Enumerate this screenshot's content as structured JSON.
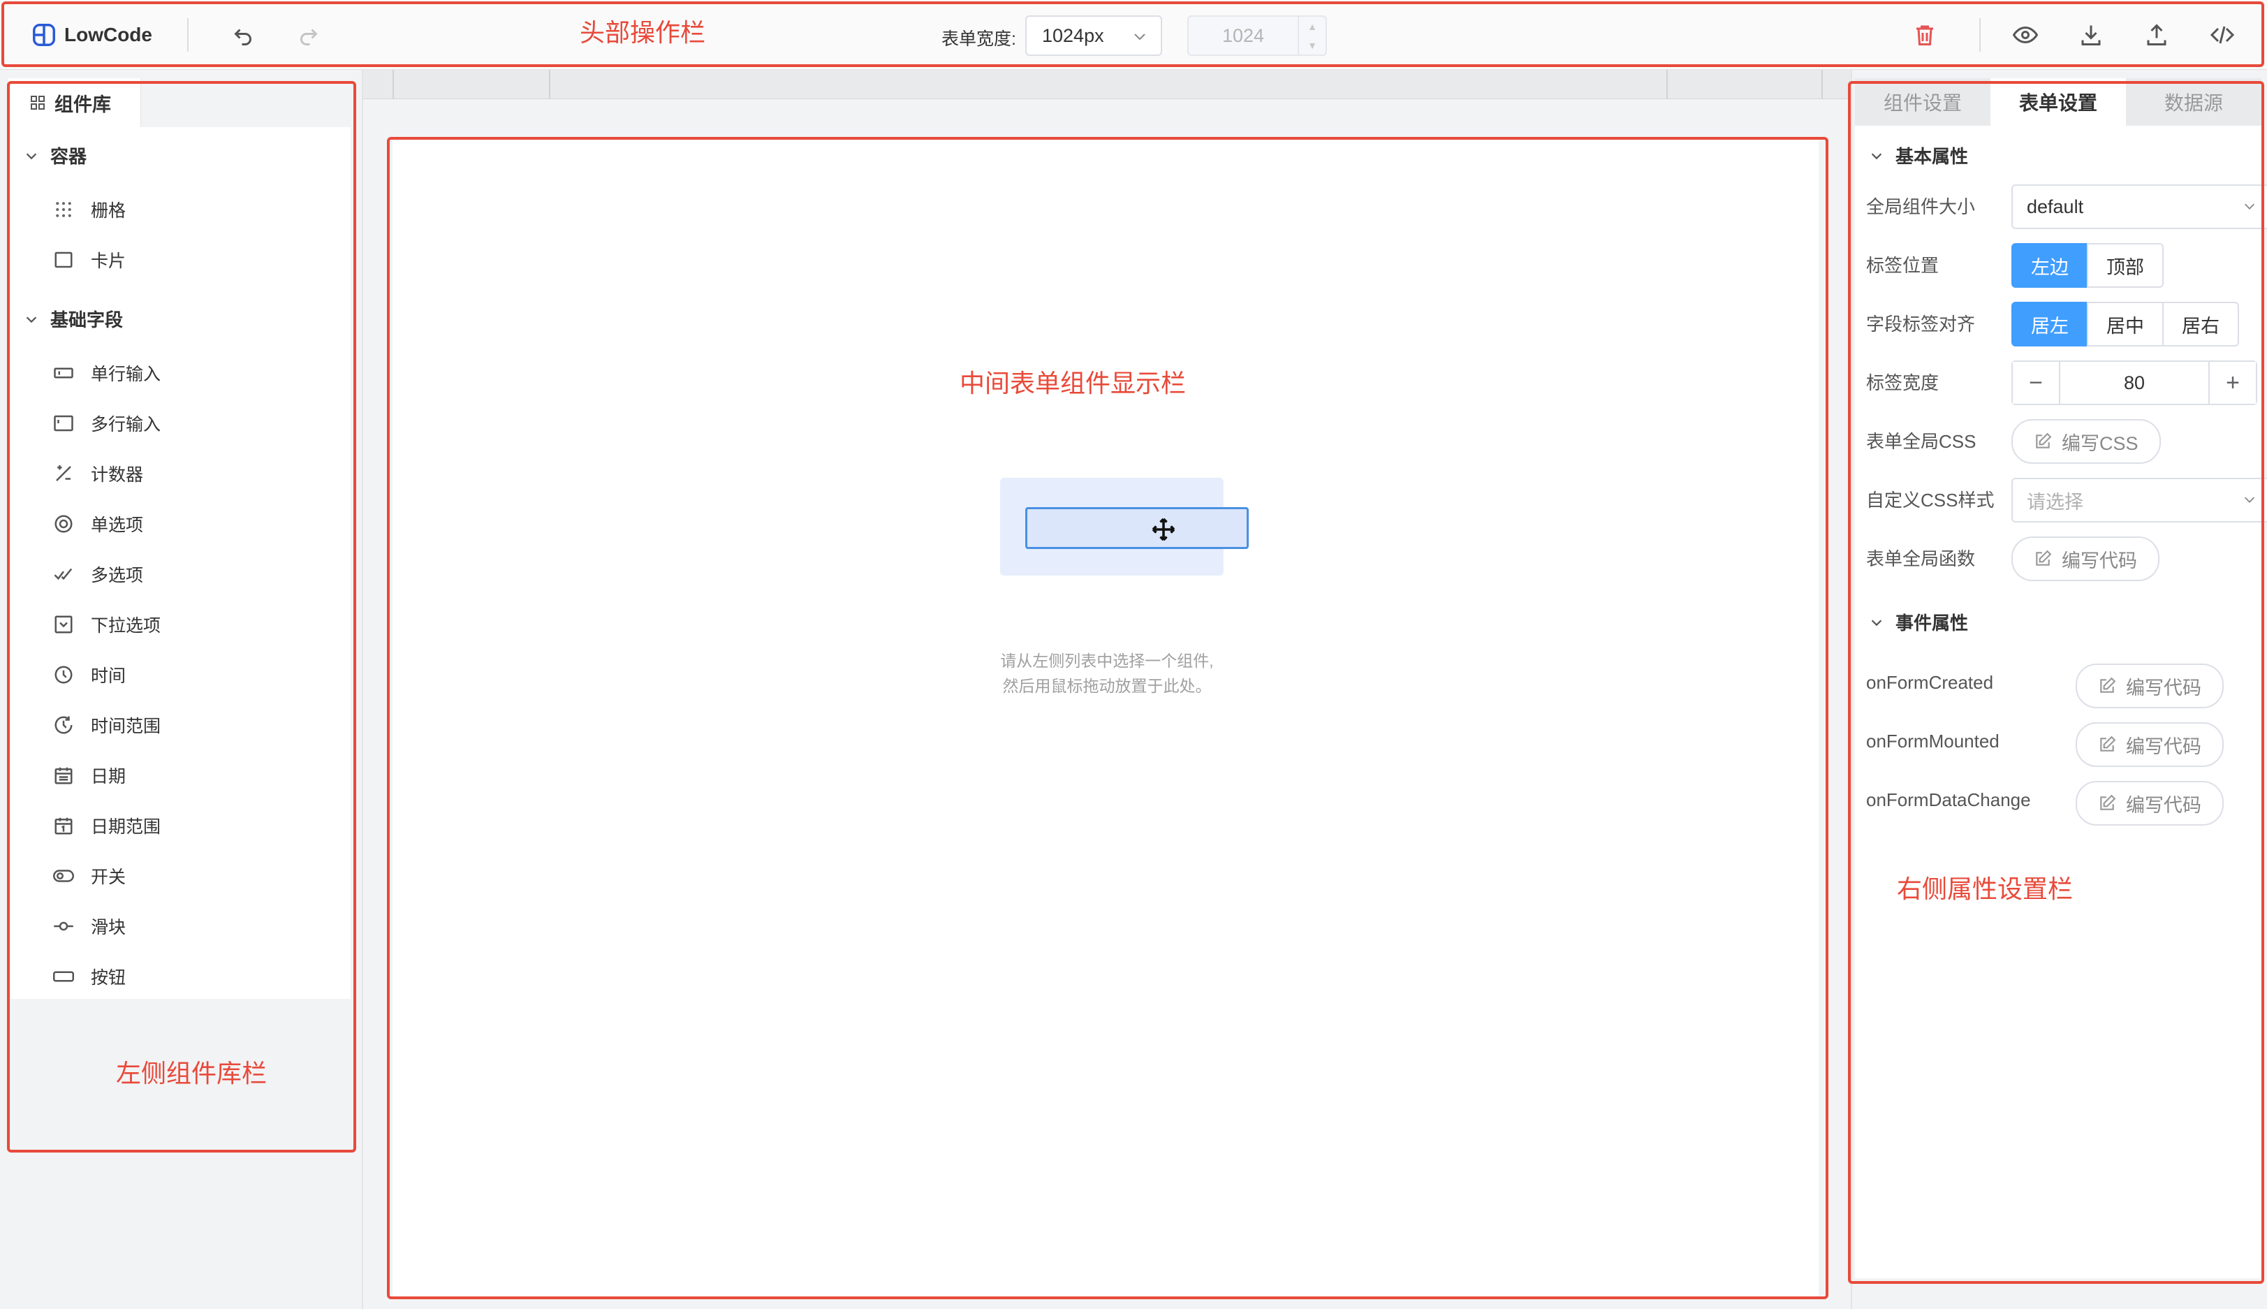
{
  "header": {
    "logo_text": "LowCode",
    "undo_icon": "undo-icon",
    "redo_icon": "redo-icon",
    "form_width_label": "表单宽度:",
    "form_width_value": "1024px",
    "form_width_number": "1024",
    "icons": [
      "delete-icon",
      "preview-icon",
      "import-icon",
      "export-icon",
      "code-icon"
    ]
  },
  "annotations": {
    "header": "头部操作栏",
    "center": "中间表单组件显示栏",
    "left": "左侧组件库栏",
    "right": "右侧属性设置栏"
  },
  "left": {
    "tab": "组件库",
    "groups": [
      {
        "title": "容器",
        "items": [
          {
            "label": "栅格",
            "icon": "grid-icon"
          },
          {
            "label": "卡片",
            "icon": "card-icon"
          }
        ]
      },
      {
        "title": "基础字段",
        "items": [
          {
            "label": "单行输入",
            "icon": "input-icon"
          },
          {
            "label": "多行输入",
            "icon": "textarea-icon"
          },
          {
            "label": "计数器",
            "icon": "counter-icon"
          },
          {
            "label": "单选项",
            "icon": "radio-icon"
          },
          {
            "label": "多选项",
            "icon": "checkbox-icon"
          },
          {
            "label": "下拉选项",
            "icon": "select-icon"
          },
          {
            "label": "时间",
            "icon": "time-icon"
          },
          {
            "label": "时间范围",
            "icon": "time-range-icon"
          },
          {
            "label": "日期",
            "icon": "date-icon"
          },
          {
            "label": "日期范围",
            "icon": "date-range-icon"
          },
          {
            "label": "开关",
            "icon": "switch-icon"
          },
          {
            "label": "滑块",
            "icon": "slider-icon"
          },
          {
            "label": "按钮",
            "icon": "button-icon"
          }
        ]
      }
    ]
  },
  "canvas": {
    "hint_line1": "请从左侧列表中选择一个组件,",
    "hint_line2": "然后用鼠标拖动放置于此处。"
  },
  "right": {
    "tabs": [
      "组件设置",
      "表单设置",
      "数据源"
    ],
    "active_tab": "表单设置",
    "basic_section": "基本属性",
    "global_size_label": "全局组件大小",
    "global_size_value": "default",
    "label_position_label": "标签位置",
    "label_position_options": [
      "左边",
      "顶部"
    ],
    "label_position_selected": "左边",
    "label_align_label": "字段标签对齐",
    "label_align_options": [
      "居左",
      "居中",
      "居右"
    ],
    "label_align_selected": "居左",
    "label_width_label": "标签宽度",
    "label_width_value": "80",
    "global_css_label": "表单全局CSS",
    "write_css": "编写CSS",
    "custom_css_label": "自定义CSS样式",
    "custom_css_placeholder": "请选择",
    "global_func_label": "表单全局函数",
    "write_code": "编写代码",
    "event_section": "事件属性",
    "events": [
      "onFormCreated",
      "onFormMounted",
      "onFormDataChange"
    ]
  },
  "colors": {
    "accent": "#409eff",
    "annotation": "#e84a3a"
  }
}
